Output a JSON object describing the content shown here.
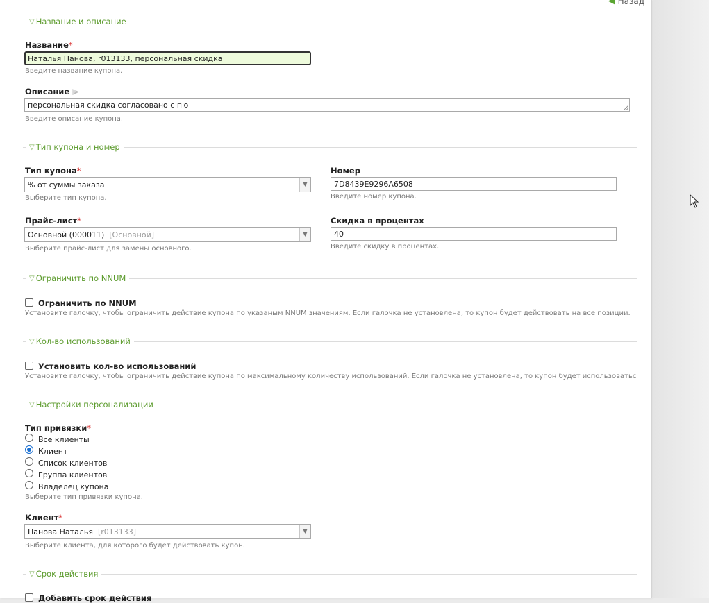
{
  "header": {
    "back_label": "Назад"
  },
  "sections": {
    "name_desc": "Название и описание",
    "type_number": "Тип купона и номер",
    "nnum": "Ограничить по NNUM",
    "usage": "Кол-во использований",
    "personal": "Настройки персонализации",
    "validity": "Срок действия"
  },
  "name": {
    "label": "Название",
    "required": "*",
    "value": "Наталья Панова, r013133, персональная скидка",
    "hint": "Введите название купона."
  },
  "description": {
    "label": "Описание",
    "value": "персональная скидка согласовано с пю",
    "hint": "Введите описание купона."
  },
  "coupon_type": {
    "label": "Тип купона",
    "required": "*",
    "value": "% от суммы заказа",
    "hint": "Выберите тип купона."
  },
  "number": {
    "label": "Номер",
    "value": "7D8439E9296A6508",
    "hint": "Введите номер купона."
  },
  "price_list": {
    "label": "Прайс-лист",
    "required": "*",
    "value": "Основной (000011)",
    "value_extra": "[Основной]",
    "hint": "Выберите прайс-лист для замены основного."
  },
  "discount": {
    "label": "Скидка в процентах",
    "value": "40",
    "hint": "Введите скидку в процентах."
  },
  "nnum_limit": {
    "label": "Ограничить по NNUM",
    "hint": "Установите галочку, чтобы ограничить действие купона по указаным NNUM значениям. Если галочка не установлена, то купон будет действовать на все позиции."
  },
  "usage_limit": {
    "label": "Установить кол-во использований",
    "hint": "Установите галочку, чтобы ограничить действие купона по максимальному количеству использований. Если галочка не установлена, то купон будет использоваться"
  },
  "binding": {
    "label": "Тип привязки",
    "required": "*",
    "options": [
      "Все клиенты",
      "Клиент",
      "Список клиентов",
      "Группа клиентов",
      "Владелец купона"
    ],
    "selected_index": 1,
    "hint": "Выберите тип привязки купона."
  },
  "client": {
    "label": "Клиент",
    "required": "*",
    "value": "Панова Наталья",
    "value_extra": "[r013133]",
    "hint": "Выберите клиента, для которого будет действовать купон."
  },
  "validity": {
    "label": "Добавить срок действия"
  },
  "colors": {
    "section_green": "#5c9b2d",
    "required_red": "#d51f1f",
    "focused_bg": "#eefbdc",
    "radio_blue": "#1a6fd1"
  }
}
